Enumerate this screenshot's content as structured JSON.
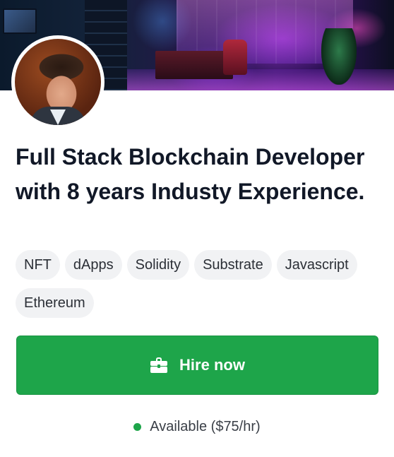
{
  "profile": {
    "title": "Full Stack Blockchain Developer with 8 years Industy Experience.",
    "tags": [
      "NFT",
      "dApps",
      "Solidity",
      "Substrate",
      "Javascript",
      "Ethereum"
    ]
  },
  "actions": {
    "hire_label": "Hire now",
    "hire_icon": "briefcase-icon",
    "accent_color": "#1ea54a"
  },
  "availability": {
    "status_text": "Available ($75/hr)",
    "status_color": "#1ea54a"
  }
}
